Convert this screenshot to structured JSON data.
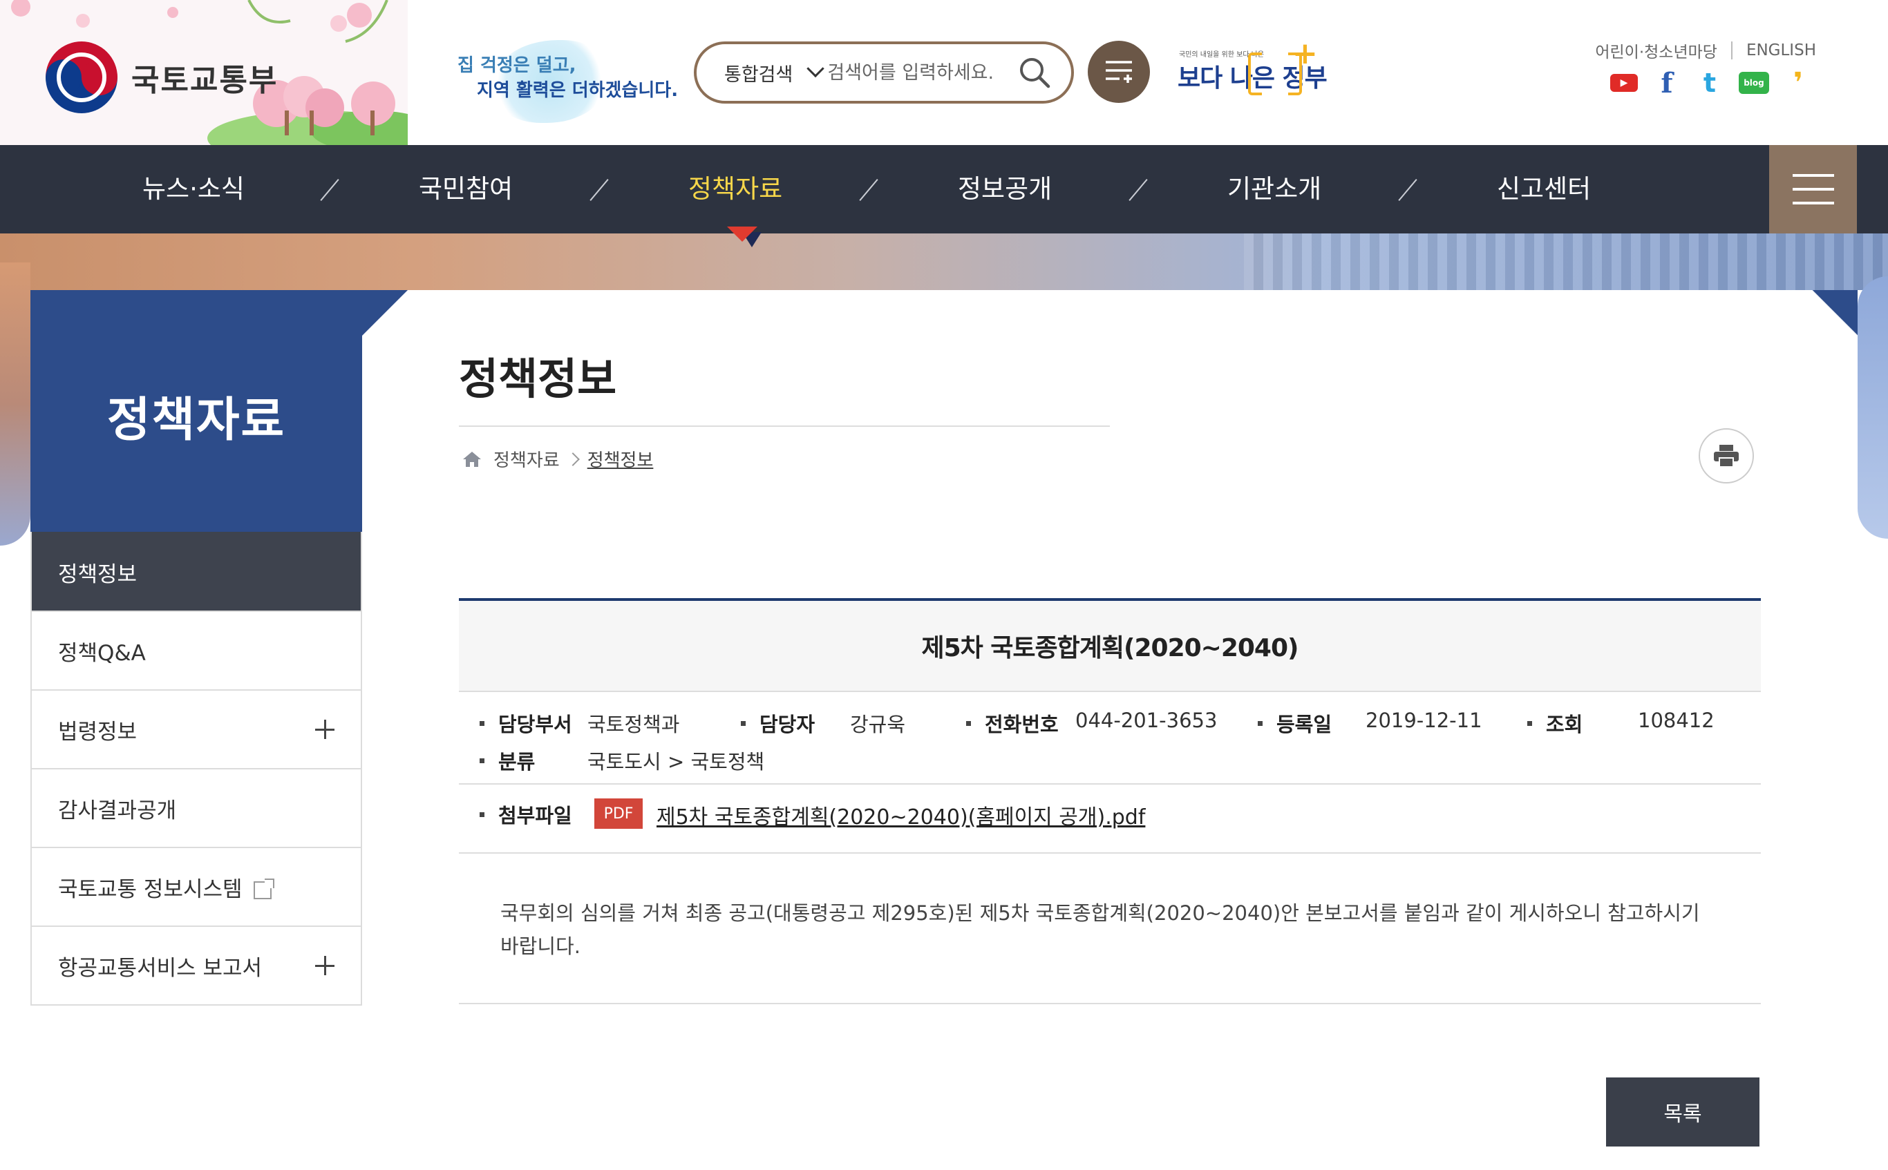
{
  "header": {
    "logo_text": "국토교통부",
    "slogan_line1": "집 걱정은 덜고,",
    "slogan_line2": "지역 활력은 더하겠습니다.",
    "search": {
      "scope": "통합검색",
      "placeholder": "검색어를 입력하세요."
    },
    "better_gov": {
      "small": "국민의 내일을 위한 보다 나은",
      "main": "보다 나은 정부"
    },
    "util_links": [
      "어린이·청소년마당",
      "ENGLISH"
    ],
    "sns": [
      {
        "name": "youtube-icon",
        "label": "▶",
        "color": "#e02b27"
      },
      {
        "name": "facebook-icon",
        "label": "f",
        "color": "#2f5fb3"
      },
      {
        "name": "twitter-icon",
        "label": "t",
        "color": "#2aa6e0"
      },
      {
        "name": "blog-icon",
        "label": "blog",
        "color": "#33b34a"
      },
      {
        "name": "kakao-story-icon",
        "label": "❜",
        "color": "#f3b51c"
      }
    ]
  },
  "gnb": {
    "items": [
      "뉴스·소식",
      "국민참여",
      "정책자료",
      "정보공개",
      "기관소개",
      "신고센터"
    ],
    "active": "정책자료"
  },
  "lnb": {
    "title": "정책자료",
    "items": [
      {
        "label": "정책정보",
        "active": true,
        "expand": false,
        "external": false
      },
      {
        "label": "정책Q&A",
        "active": false,
        "expand": false,
        "external": false
      },
      {
        "label": "법령정보",
        "active": false,
        "expand": true,
        "external": false
      },
      {
        "label": "감사결과공개",
        "active": false,
        "expand": false,
        "external": false
      },
      {
        "label": "국토교통 정보시스템",
        "active": false,
        "expand": false,
        "external": true
      },
      {
        "label": "항공교통서비스 보고서",
        "active": false,
        "expand": true,
        "external": false
      }
    ]
  },
  "page": {
    "title": "정책정보",
    "breadcrumb": [
      "정책자료",
      "정책정보"
    ]
  },
  "post": {
    "subject": "제5차 국토종합계획(2020~2040)",
    "dept_label": "담당부서",
    "dept": "국토정책과",
    "manager_label": "담당자",
    "manager": "강규욱",
    "phone_label": "전화번호",
    "phone": "044-201-3653",
    "date_label": "등록일",
    "date": "2019-12-11",
    "views_label": "조회",
    "views": "108412",
    "category_label": "분류",
    "category": "국토도시 > 국토정책",
    "attach_label": "첨부파일",
    "attach_type": "PDF",
    "attach_name": "제5차 국토종합계획(2020~2040)(홈페이지 공개).pdf",
    "body": "국무회의 심의를 거쳐 최종 공고(대통령공고 제295호)된 제5차 국토종합계획(2020~2040)안 본보고서를 붙임과 같이 게시하오니 참고하시기 바랍니다."
  },
  "buttons": {
    "list": "목록"
  },
  "colors": {
    "gnb_bg": "#2d3340",
    "gnb_active": "#f7d74a",
    "lnb_head": "#2d4c8a",
    "accent_brown": "#8c6f56"
  }
}
